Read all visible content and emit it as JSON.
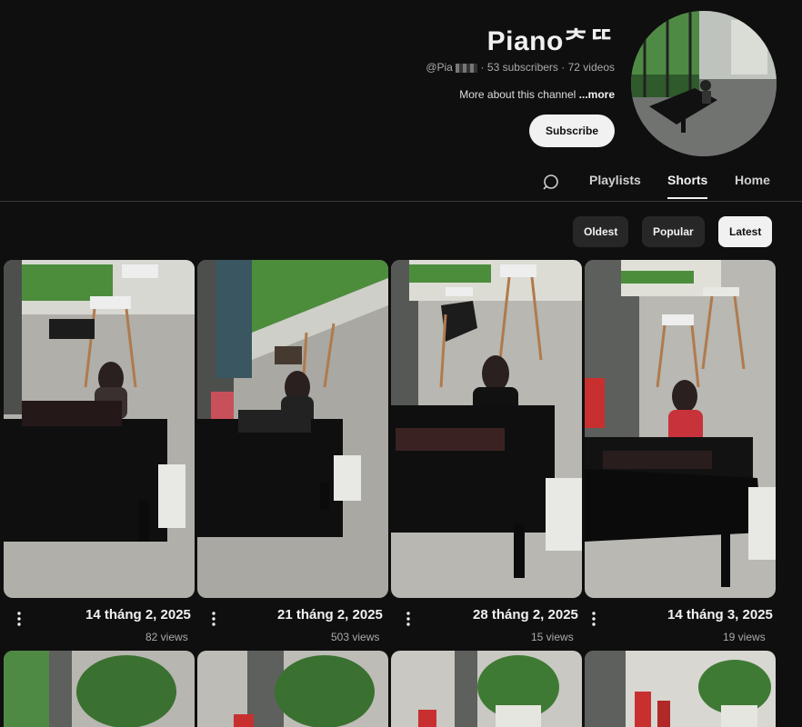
{
  "channel": {
    "name": "Pianoᅔᄄ",
    "handle": "@Pia",
    "subscribers": "53 subscribers",
    "videos": "72 videos",
    "description": "More about this channel ",
    "more_label": "...more",
    "subscribe_label": "Subscribe"
  },
  "tabs": [
    {
      "label": "Home"
    },
    {
      "label": "Shorts",
      "active": true
    },
    {
      "label": "Playlists"
    }
  ],
  "filters": [
    {
      "label": "Latest",
      "active": true
    },
    {
      "label": "Popular"
    },
    {
      "label": "Oldest"
    }
  ],
  "shorts": [
    {
      "title": "14 tháng 3, 2025",
      "views": "19 views",
      "outfit": "#c8333b"
    },
    {
      "title": "28 tháng 2, 2025",
      "views": "15 views",
      "outfit": "#111111"
    },
    {
      "title": "21 tháng 2, 2025",
      "views": "503 views",
      "outfit": "#222222"
    },
    {
      "title": "14 tháng 2, 2025",
      "views": "82 views",
      "outfit": "#3a3030"
    }
  ],
  "icons": {
    "search": "search-icon",
    "more": "more-vert-icon"
  }
}
